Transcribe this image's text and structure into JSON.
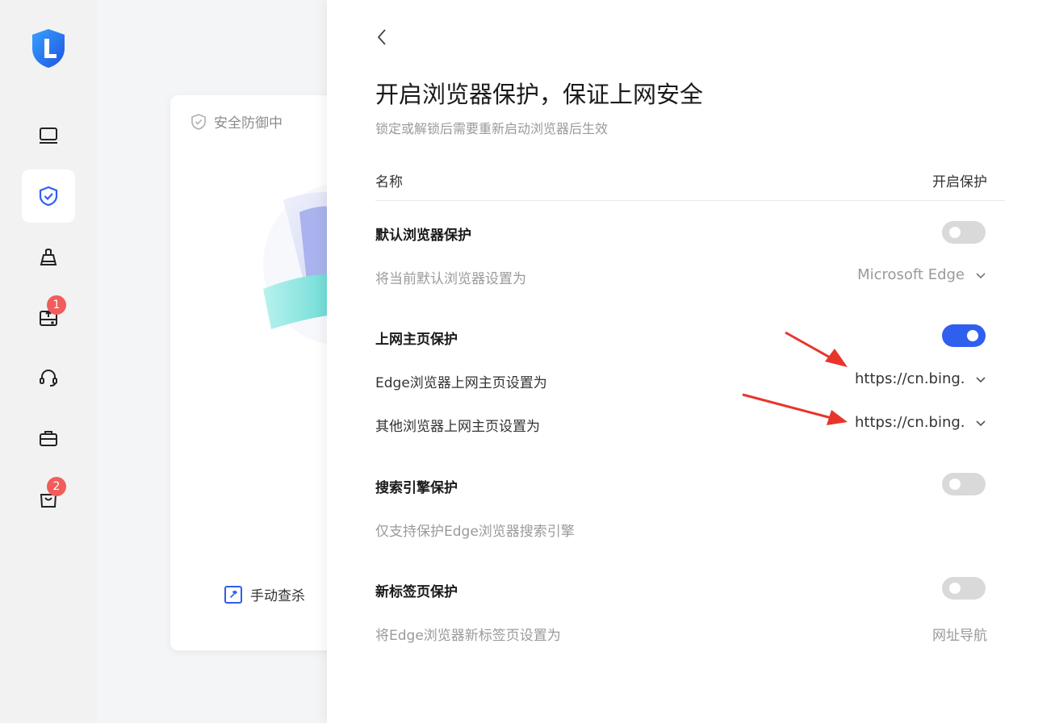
{
  "sidebar": {
    "badges": [
      "1",
      "2"
    ]
  },
  "background_card": {
    "status": "安全防御中",
    "manual_scan": "手动查杀"
  },
  "panel": {
    "title": "开启浏览器保护，保证上网安全",
    "subtitle": "锁定或解锁后需要重新启动浏览器后生效",
    "header": {
      "name": "名称",
      "status": "开启保护"
    },
    "sections": {
      "default_browser": {
        "title": "默认浏览器保护",
        "enabled": false,
        "label": "将当前默认浏览器设置为",
        "value": "Microsoft Edge"
      },
      "homepage": {
        "title": "上网主页保护",
        "enabled": true,
        "edge_label": "Edge浏览器上网主页设置为",
        "edge_value": "https://cn.bing.com",
        "other_label": "其他浏览器上网主页设置为",
        "other_value": "https://cn.bing.com"
      },
      "search_engine": {
        "title": "搜索引擎保护",
        "enabled": false,
        "label": "仅支持保护Edge浏览器搜索引擎"
      },
      "new_tab": {
        "title": "新标签页保护",
        "enabled": false,
        "label": "将Edge浏览器新标签页设置为",
        "value": "网址导航"
      }
    }
  },
  "colors": {
    "accent": "#2f5fef",
    "annotation_arrow": "#e8352b",
    "badge": "#f25c5c"
  }
}
